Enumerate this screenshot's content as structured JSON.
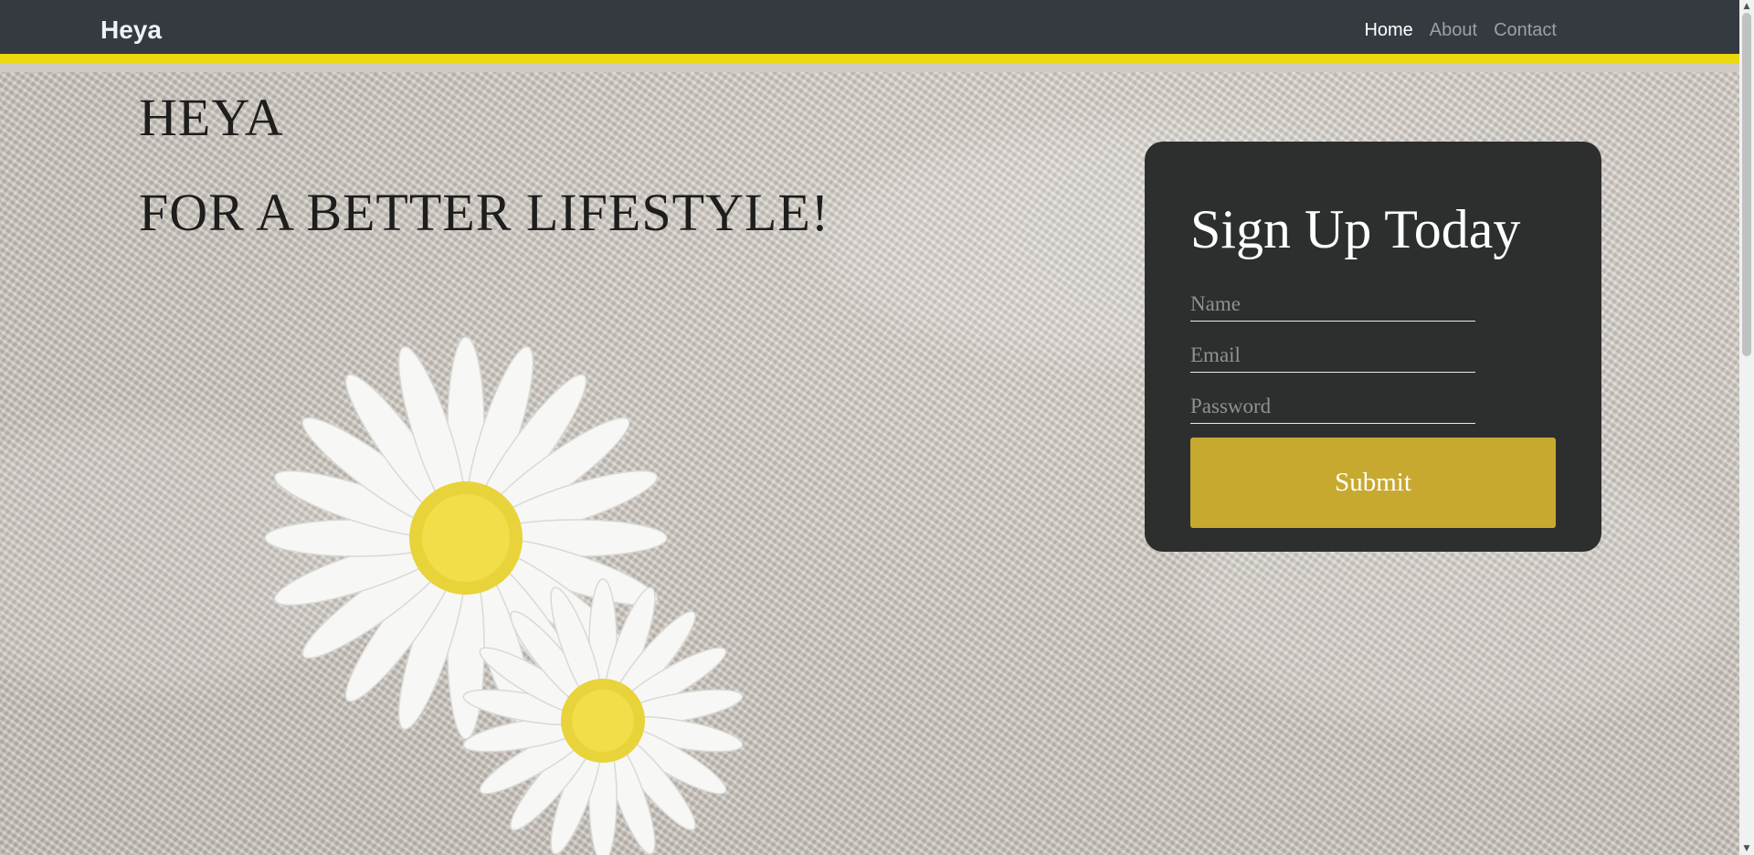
{
  "navbar": {
    "brand": "Heya",
    "links": [
      {
        "label": "Home"
      },
      {
        "label": "About"
      },
      {
        "label": "Contact"
      }
    ],
    "accent_color": "#ebd80f",
    "background_color": "#343a40"
  },
  "hero": {
    "line1": "HEYA",
    "line2": "FOR A BETTER LIFESTYLE!",
    "background_image": "burlap-daisy-image"
  },
  "signup": {
    "title": "Sign Up Today",
    "name_placeholder": "Name",
    "email_placeholder": "Email",
    "password_placeholder": "Password",
    "submit_label": "Submit",
    "button_color": "#c8a92f",
    "card_color": "#2d2f2f"
  },
  "scrollbar": {
    "up_icon": "arrow-up-icon",
    "down_icon": "arrow-down-icon"
  }
}
